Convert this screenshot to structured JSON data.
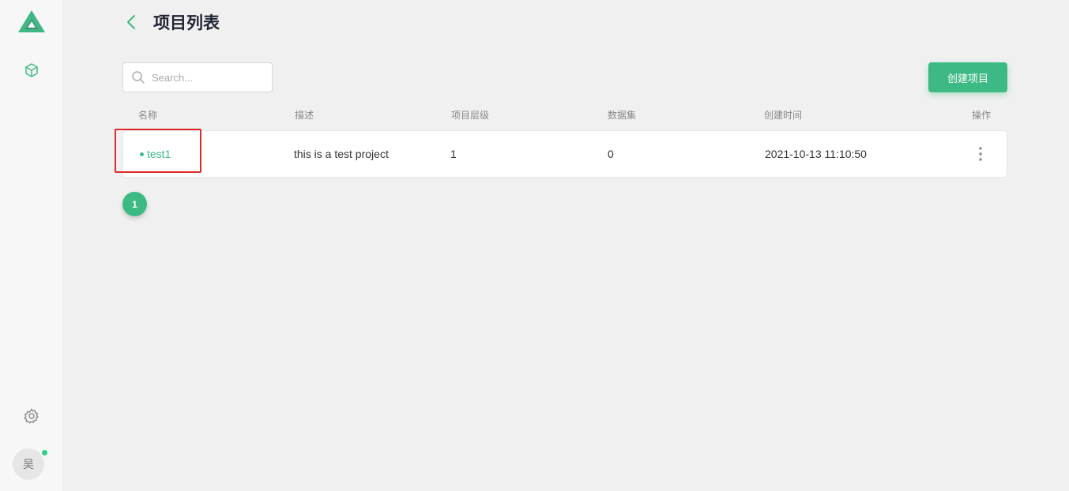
{
  "sidebar": {
    "logo_icon": "triangle-logo-icon",
    "nav_items": [
      {
        "icon": "cube-icon"
      }
    ],
    "settings_icon": "gear-icon",
    "avatar_text": "吴",
    "status_color": "#2ecf8f"
  },
  "header": {
    "back_icon": "chevron-left-icon",
    "title": "项目列表"
  },
  "search": {
    "placeholder": "Search...",
    "value": ""
  },
  "toolbar": {
    "create_label": "创建项目"
  },
  "table": {
    "columns": [
      "名称",
      "描述",
      "项目层级",
      "数据集",
      "创建时间",
      "操作"
    ],
    "rows": [
      {
        "name": "test1",
        "description": "this is a test project",
        "level": "1",
        "datasets": "0",
        "created_at": "2021-10-13 11:10:50",
        "action_icon": "more-vertical-icon"
      }
    ]
  },
  "pagination": {
    "current_page": "1"
  },
  "colors": {
    "accent": "#3dba84",
    "highlight": "#e02a2a"
  }
}
